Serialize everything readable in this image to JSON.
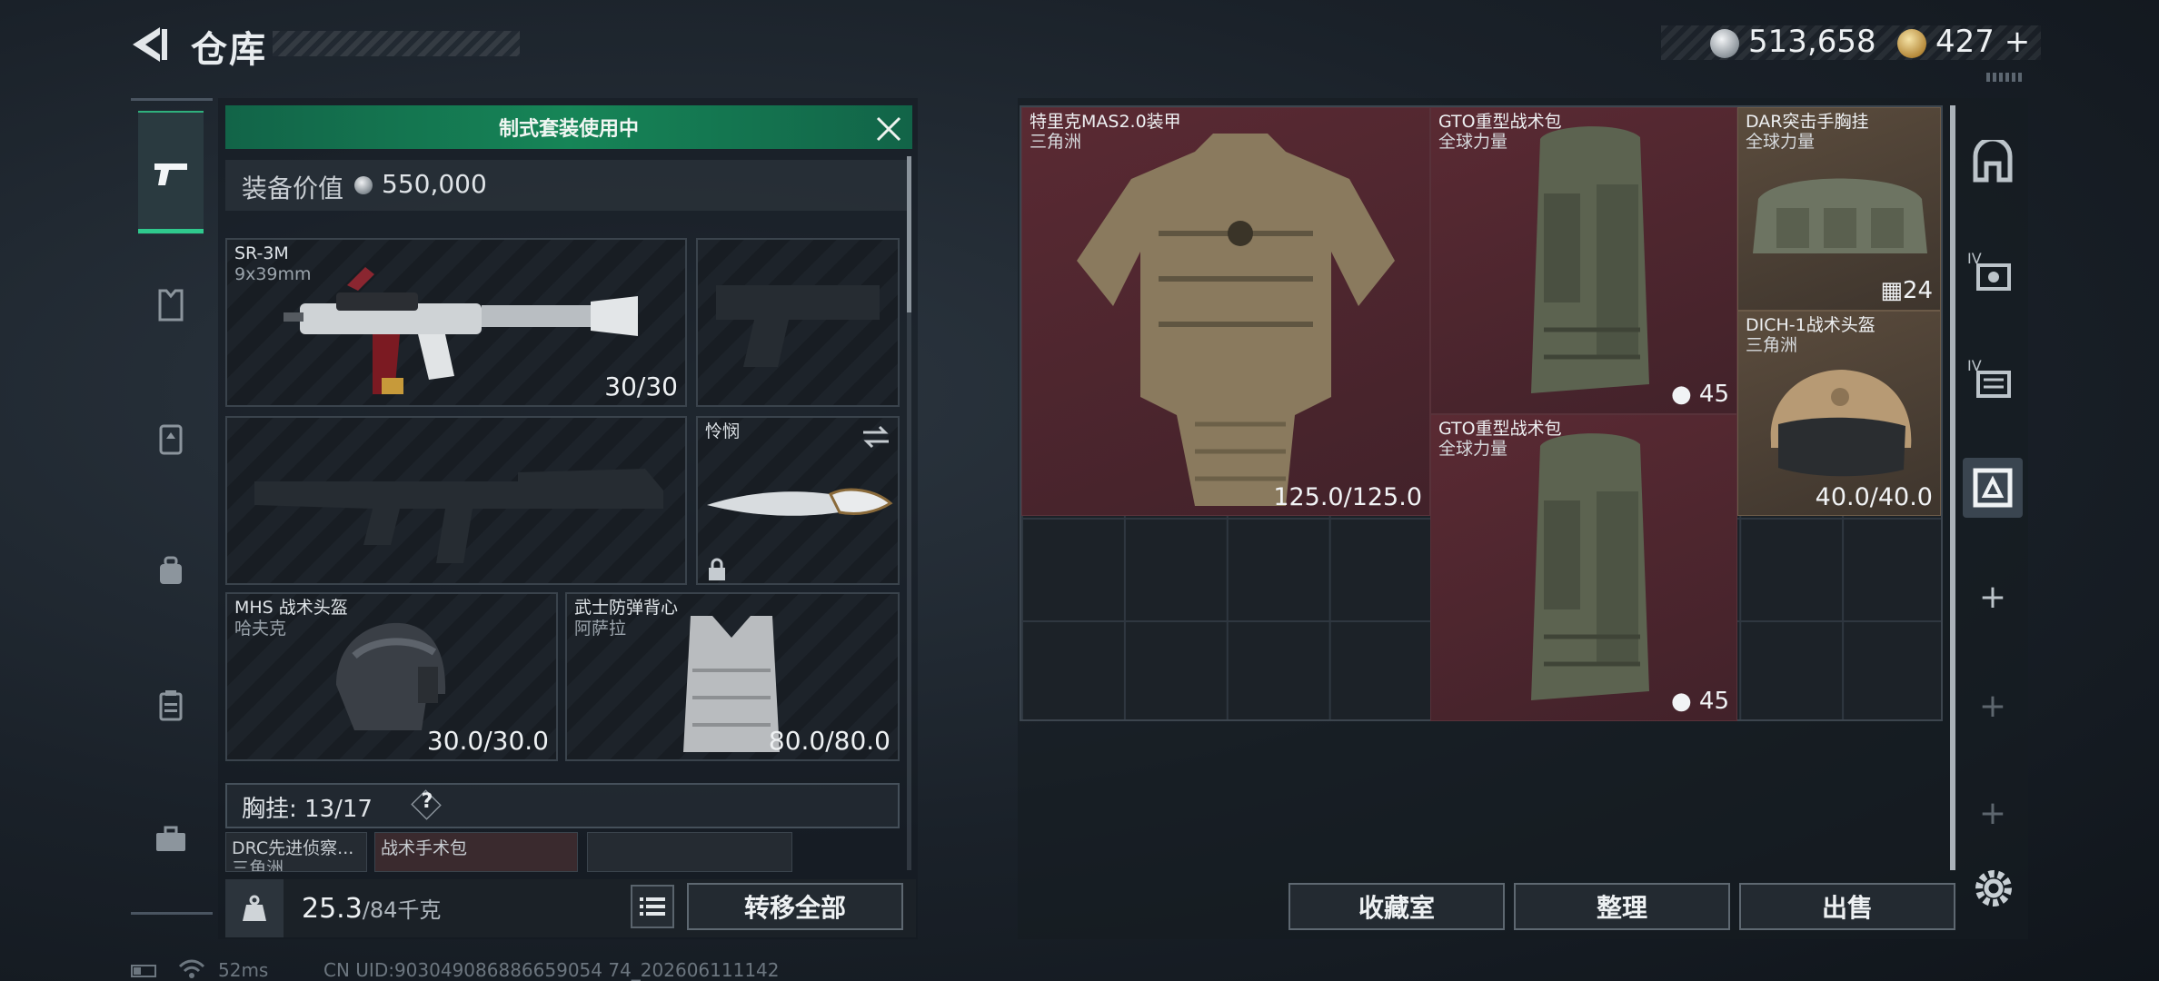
{
  "header": {
    "title": "仓库",
    "money": "513,658",
    "tokens": "427",
    "tokens_plus": "+"
  },
  "loadout": {
    "banner": "制式套装使用中",
    "value_label": "装备价值",
    "value_amount": "550,000",
    "primary": {
      "name": "SR-3M",
      "sub": "9x39mm",
      "ammo": "30/30"
    },
    "melee": {
      "name": "怜悯"
    },
    "helmet": {
      "name": "MHS 战术头盔",
      "sub": "哈夫克",
      "durability": "30.0/30.0"
    },
    "armor": {
      "name": "武士防弹背心",
      "sub": "阿萨拉",
      "durability": "80.0/80.0"
    },
    "rig": {
      "label": "胸挂:",
      "count": "13/17",
      "help": "?"
    },
    "rig_items": [
      {
        "name": "DRC先进侦察...",
        "sub": "三角洲"
      },
      {
        "name": "战术手术包",
        "sub": ""
      }
    ],
    "weight": {
      "current": "25.3",
      "max": "/84千克"
    },
    "transfer_label": "转移全部"
  },
  "storage": {
    "items": [
      {
        "name": "特里克MAS2.0装甲",
        "sub": "三角洲",
        "value": "125.0/125.0"
      },
      {
        "name": "GTO重型战术包",
        "sub": "全球力量",
        "value": "45"
      },
      {
        "name": "DAR突击手胸挂",
        "sub": "全球力量",
        "value": "24"
      },
      {
        "name": "DICH-1战术头盔",
        "sub": "三角洲",
        "value": "40.0/40.0"
      },
      {
        "name": "GTO重型战术包",
        "sub": "全球力量",
        "value": "45"
      }
    ],
    "tab_labels": [
      "IV",
      "IV"
    ],
    "add_symbol": "+",
    "buttons": {
      "collection": "收藏室",
      "sort": "整理",
      "sell": "出售"
    }
  },
  "status": {
    "ping": "52ms",
    "uid": "CN UID:903049086886659054 74_202606111142"
  },
  "colors": {
    "accent_green": "#168557",
    "item_red": "#5a2a33",
    "item_tan": "#5b4c3d"
  },
  "icons": [
    "back-arrow-icon",
    "silver-coin-icon",
    "gold-coin-icon",
    "pistol-icon",
    "armor-icon",
    "backpack-icon",
    "rig-icon",
    "medkit-icon",
    "briefcase-icon",
    "close-icon",
    "lock-icon",
    "swap-icon",
    "weight-icon",
    "list-icon",
    "gear-icon"
  ]
}
